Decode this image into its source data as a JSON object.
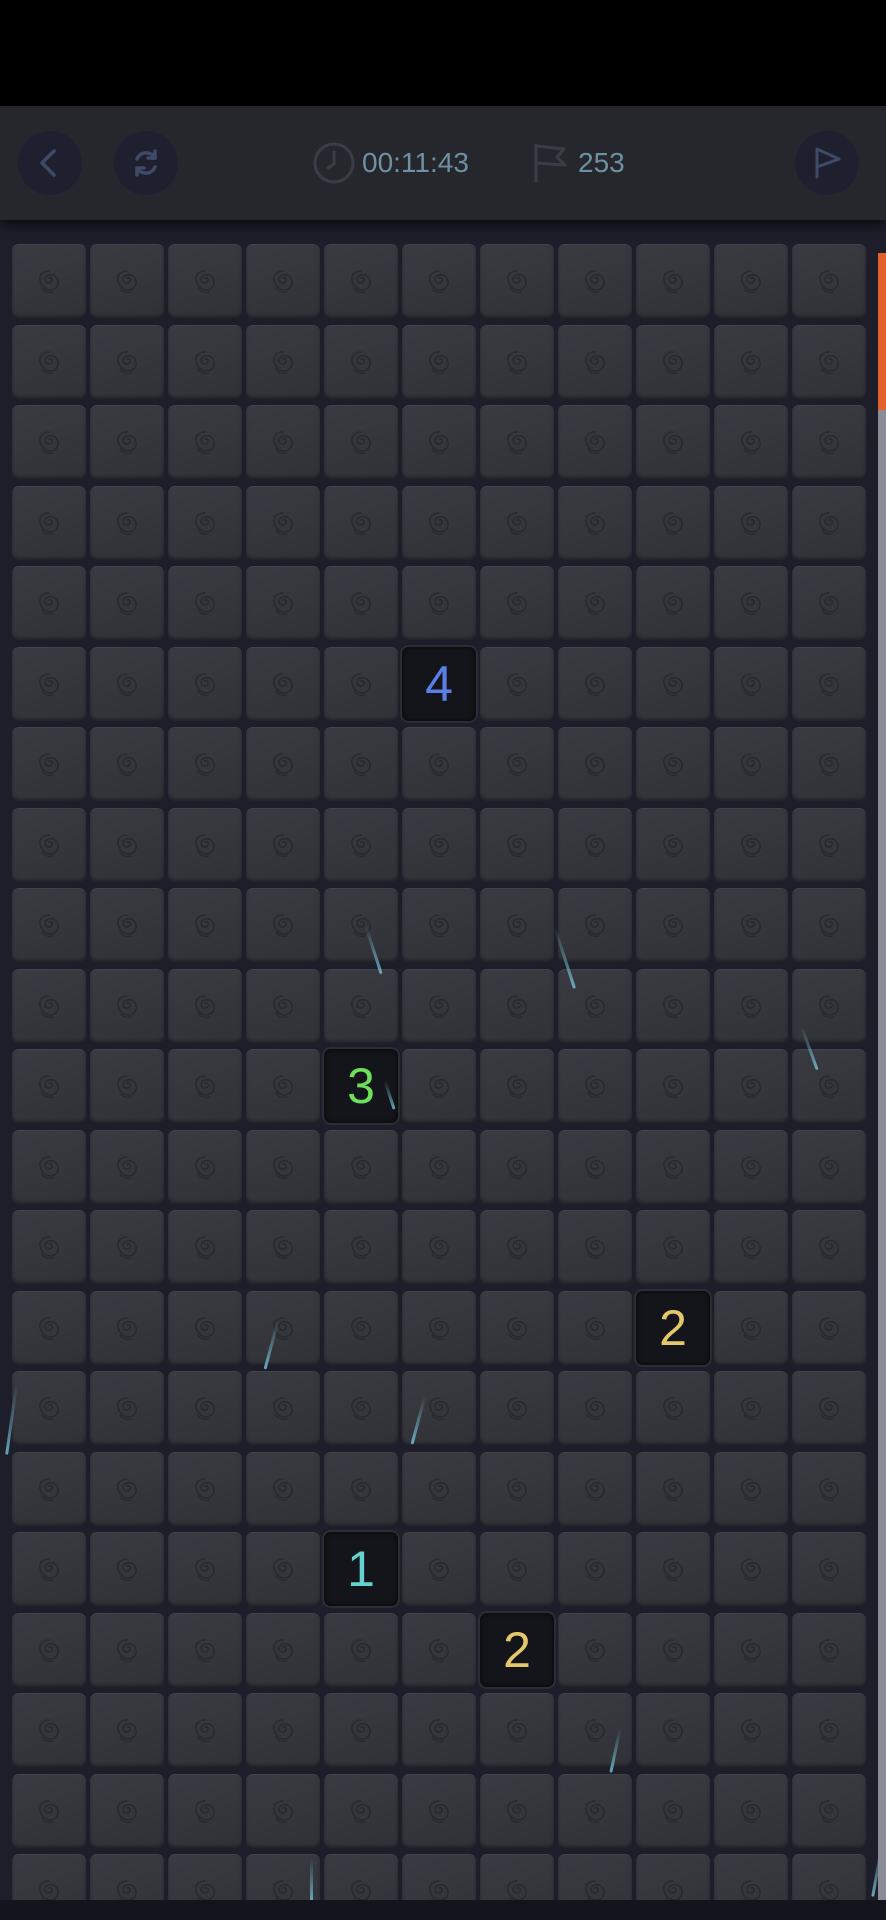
{
  "toolbar": {
    "timer": "00:11:43",
    "flags_remaining": "253",
    "back_icon": "chevron-left-icon",
    "restart_icon": "refresh-icon",
    "flag_mode_icon": "flag-outline-icon",
    "timer_icon": "clock-icon",
    "flags_icon": "flag-icon"
  },
  "board": {
    "columns": 11,
    "visible_rows": 21,
    "tile_icon": "rose-icon",
    "revealed": [
      {
        "row": 5,
        "col": 5,
        "value": "4",
        "color": "#5b7fe6"
      },
      {
        "row": 10,
        "col": 4,
        "value": "3",
        "color": "#6fde5a"
      },
      {
        "row": 13,
        "col": 8,
        "value": "2",
        "color": "#e3c76a"
      },
      {
        "row": 16,
        "col": 4,
        "value": "1",
        "color": "#64d3d0"
      },
      {
        "row": 17,
        "col": 6,
        "value": "2",
        "color": "#e3c76a"
      }
    ]
  },
  "colors": {
    "accent_scroll": "#e0612a",
    "toolbar_text": "#6f8fa3"
  }
}
